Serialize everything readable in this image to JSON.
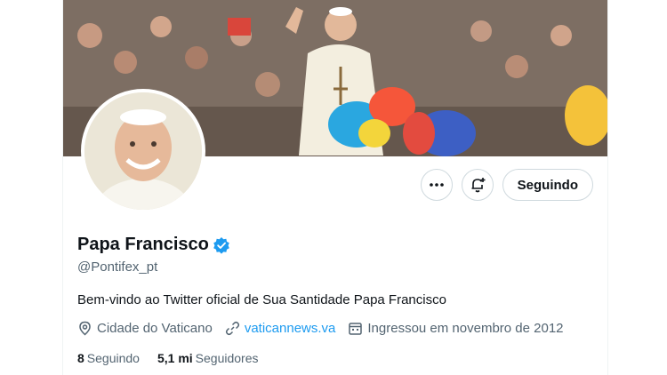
{
  "profile": {
    "name": "Papa Francisco",
    "handle": "@Pontifex_pt",
    "bio": "Bem-vindo ao Twitter oficial de Sua Santidade Papa Francisco",
    "verified": true
  },
  "actions": {
    "more_icon": "more-icon",
    "notify_icon": "bell-plus-icon",
    "follow_label": "Seguindo"
  },
  "meta": {
    "location": "Cidade do Vaticano",
    "website": "vaticannews.va",
    "joined": "Ingressou em novembro de 2012"
  },
  "stats": {
    "following_count": "8",
    "following_label": "Seguindo",
    "followers_count": "5,1 mi",
    "followers_label": "Seguidores"
  },
  "colors": {
    "accent": "#1d9bf0",
    "secondary_text": "#536471",
    "border": "#cfd9de"
  }
}
